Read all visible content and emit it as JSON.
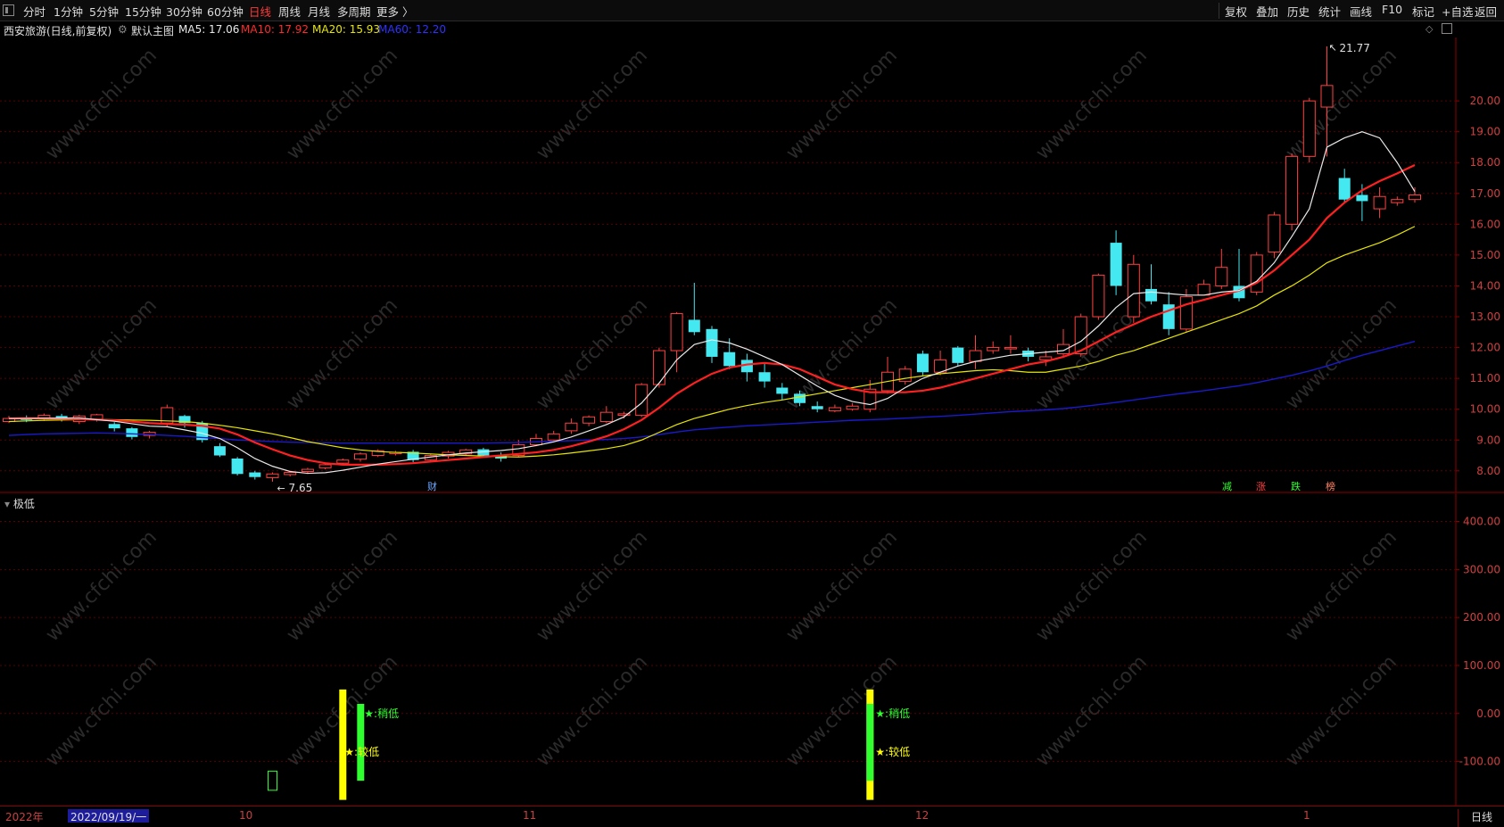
{
  "toolbar": {
    "periods": [
      "分时",
      "1分钟",
      "5分钟",
      "15分钟",
      "30分钟",
      "60分钟",
      "日线",
      "周线",
      "月线",
      "多周期",
      "更多 〉"
    ],
    "active_period": "日线",
    "right_buttons": [
      "复权",
      "叠加",
      "历史",
      "统计",
      "画线",
      "F10",
      "标记",
      "+自选",
      "返回"
    ]
  },
  "info": {
    "stock": "西安旅游(日线,前复权)",
    "template": "默认主图",
    "ma5": "MA5: 17.06",
    "ma10": "MA10: 17.92",
    "ma20": "MA20: 15.93",
    "ma60": "MA60: 12.20"
  },
  "colors": {
    "up": "#ff4040",
    "down": "#44e8f0",
    "ma5": "#e8e8e8",
    "ma10": "#ff2020",
    "ma20": "#e6e600",
    "ma60": "#1a1acc",
    "grid": "#5a0000",
    "axis": "#d04040"
  },
  "watermark": "www.cfchi.com",
  "main_axis": {
    "labels": [
      "20.00",
      "19.00",
      "18.00",
      "17.00",
      "16.00",
      "15.00",
      "14.00",
      "13.00",
      "12.00",
      "11.00",
      "10.00",
      "9.00",
      "8.00"
    ]
  },
  "annotations": {
    "high": "21.77",
    "low": "7.65",
    "event_cai": "财",
    "event_tags": [
      "减",
      "涨",
      "跌",
      "榜"
    ]
  },
  "sub_panel": {
    "title": "极低",
    "axis_labels": [
      "400.00",
      "300.00",
      "200.00",
      "100.00",
      "0.00",
      "-100.00"
    ],
    "signals": [
      {
        "label": "★:稍低",
        "color": "#30ff30"
      },
      {
        "label": "★:较低",
        "color": "#ffff00"
      },
      {
        "label": "★:稍低",
        "color": "#30ff30"
      },
      {
        "label": "★:较低",
        "color": "#ffff00"
      }
    ]
  },
  "date_axis": {
    "year": "2022年",
    "cursor": "2022/09/19/一",
    "months": [
      "10",
      "11",
      "12",
      "1"
    ],
    "period_tab": "日线"
  },
  "chart_data": {
    "type": "candlestick",
    "title": "西安旅游(日线,前复权)",
    "ylim": [
      7.3,
      22.0
    ],
    "candles": [
      [
        9.6,
        9.7,
        9.78,
        9.55
      ],
      [
        9.7,
        9.65,
        9.8,
        9.58
      ],
      [
        9.72,
        9.8,
        9.86,
        9.62
      ],
      [
        9.78,
        9.7,
        9.85,
        9.6
      ],
      [
        9.6,
        9.78,
        9.82,
        9.52
      ],
      [
        9.68,
        9.82,
        9.85,
        9.6
      ],
      [
        9.52,
        9.38,
        9.58,
        9.28
      ],
      [
        9.38,
        9.1,
        9.42,
        9.02
      ],
      [
        9.15,
        9.25,
        9.3,
        9.05
      ],
      [
        9.55,
        10.05,
        10.15,
        9.45
      ],
      [
        9.78,
        9.55,
        9.82,
        9.4
      ],
      [
        9.55,
        9.0,
        9.62,
        8.92
      ],
      [
        8.8,
        8.5,
        8.9,
        8.45
      ],
      [
        8.4,
        7.9,
        8.45,
        7.85
      ],
      [
        7.95,
        7.8,
        8.0,
        7.72
      ],
      [
        7.78,
        7.9,
        7.95,
        7.65
      ],
      [
        7.88,
        7.95,
        8.0,
        7.82
      ],
      [
        7.98,
        8.05,
        8.1,
        7.9
      ],
      [
        8.1,
        8.2,
        8.25,
        8.05
      ],
      [
        8.25,
        8.35,
        8.4,
        8.18
      ],
      [
        8.38,
        8.55,
        8.6,
        8.3
      ],
      [
        8.5,
        8.65,
        8.7,
        8.45
      ],
      [
        8.58,
        8.6,
        8.65,
        8.5
      ],
      [
        8.62,
        8.35,
        8.68,
        8.28
      ],
      [
        8.35,
        8.5,
        8.55,
        8.3
      ],
      [
        8.48,
        8.6,
        8.65,
        8.4
      ],
      [
        8.55,
        8.68,
        8.72,
        8.5
      ],
      [
        8.7,
        8.5,
        8.75,
        8.45
      ],
      [
        8.5,
        8.4,
        8.6,
        8.3
      ],
      [
        8.5,
        8.85,
        9.0,
        8.45
      ],
      [
        8.85,
        9.05,
        9.2,
        8.8
      ],
      [
        9.0,
        9.2,
        9.3,
        8.95
      ],
      [
        9.3,
        9.55,
        9.7,
        9.2
      ],
      [
        9.55,
        9.75,
        9.8,
        9.45
      ],
      [
        9.6,
        9.9,
        10.1,
        9.55
      ],
      [
        9.8,
        9.85,
        9.92,
        9.7
      ],
      [
        9.8,
        10.8,
        10.85,
        9.75
      ],
      [
        10.8,
        11.9,
        12.0,
        10.7
      ],
      [
        11.9,
        13.1,
        13.15,
        11.2
      ],
      [
        12.9,
        12.5,
        14.1,
        12.4
      ],
      [
        12.6,
        11.7,
        12.7,
        11.5
      ],
      [
        11.85,
        11.4,
        12.3,
        11.3
      ],
      [
        11.6,
        11.2,
        11.8,
        10.9
      ],
      [
        11.2,
        10.9,
        11.5,
        10.7
      ],
      [
        10.7,
        10.5,
        10.85,
        10.3
      ],
      [
        10.5,
        10.2,
        10.6,
        10.1
      ],
      [
        10.1,
        10.0,
        10.25,
        9.9
      ],
      [
        9.95,
        10.05,
        10.15,
        9.9
      ],
      [
        10.0,
        10.1,
        10.2,
        9.95
      ],
      [
        10.0,
        10.65,
        10.95,
        9.9
      ],
      [
        10.6,
        11.2,
        11.7,
        10.5
      ],
      [
        10.9,
        11.3,
        11.4,
        10.8
      ],
      [
        11.8,
        11.2,
        11.9,
        11.1
      ],
      [
        11.2,
        11.6,
        11.9,
        11.1
      ],
      [
        12.0,
        11.5,
        12.05,
        11.4
      ],
      [
        11.55,
        11.9,
        12.4,
        11.3
      ],
      [
        11.9,
        12.0,
        12.2,
        11.8
      ],
      [
        12.0,
        12.0,
        12.4,
        11.8
      ],
      [
        11.9,
        11.7,
        12.0,
        11.55
      ],
      [
        11.6,
        11.7,
        11.9,
        11.4
      ],
      [
        11.8,
        12.1,
        12.6,
        11.7
      ],
      [
        11.8,
        13.0,
        13.1,
        11.7
      ],
      [
        13.0,
        14.35,
        14.4,
        12.9
      ],
      [
        15.4,
        14.0,
        15.8,
        13.7
      ],
      [
        13.0,
        14.7,
        15.0,
        12.8
      ],
      [
        13.9,
        13.5,
        14.7,
        13.4
      ],
      [
        13.4,
        12.6,
        13.8,
        12.4
      ],
      [
        12.6,
        13.65,
        13.9,
        12.5
      ],
      [
        13.7,
        14.05,
        14.2,
        13.7
      ],
      [
        14.0,
        14.6,
        15.2,
        13.9
      ],
      [
        14.0,
        13.6,
        15.2,
        13.5
      ],
      [
        13.8,
        15.0,
        15.1,
        13.7
      ],
      [
        15.1,
        16.3,
        16.4,
        14.9
      ],
      [
        16.0,
        18.2,
        18.3,
        15.8
      ],
      [
        18.2,
        20.0,
        20.1,
        18.0
      ],
      [
        19.8,
        20.5,
        21.77,
        18.2
      ],
      [
        17.5,
        16.8,
        17.8,
        16.7
      ],
      [
        16.95,
        16.75,
        17.3,
        16.1
      ],
      [
        16.5,
        16.9,
        17.2,
        16.2
      ],
      [
        16.7,
        16.8,
        16.9,
        16.6
      ],
      [
        16.8,
        16.95,
        17.2,
        16.7
      ]
    ],
    "ma5": [
      9.7,
      9.7,
      9.71,
      9.71,
      9.72,
      9.66,
      9.61,
      9.53,
      9.45,
      9.43,
      9.33,
      9.22,
      9.05,
      8.75,
      8.4,
      8.15,
      7.98,
      7.92,
      7.94,
      8.02,
      8.12,
      8.22,
      8.3,
      8.38,
      8.45,
      8.52,
      8.58,
      8.62,
      8.66,
      8.72,
      8.82,
      8.94,
      9.1,
      9.3,
      9.5,
      9.75,
      10.2,
      10.85,
      11.6,
      12.1,
      12.25,
      12.15,
      11.95,
      11.7,
      11.45,
      11.1,
      10.75,
      10.45,
      10.25,
      10.15,
      10.35,
      10.7,
      11.0,
      11.2,
      11.4,
      11.55,
      11.65,
      11.75,
      11.8,
      11.85,
      11.9,
      12.2,
      12.7,
      13.3,
      13.75,
      13.8,
      13.75,
      13.7,
      13.7,
      13.8,
      13.85,
      14.15,
      14.75,
      15.6,
      16.5,
      18.5,
      18.8,
      19.0,
      18.8,
      18.0,
      17.06
    ],
    "ma10": [
      9.7,
      9.71,
      9.7,
      9.69,
      9.68,
      9.66,
      9.64,
      9.6,
      9.55,
      9.52,
      9.5,
      9.46,
      9.37,
      9.18,
      8.92,
      8.7,
      8.5,
      8.35,
      8.25,
      8.2,
      8.2,
      8.2,
      8.22,
      8.25,
      8.3,
      8.35,
      8.4,
      8.45,
      8.5,
      8.55,
      8.6,
      8.68,
      8.8,
      8.95,
      9.12,
      9.35,
      9.65,
      10.05,
      10.5,
      10.85,
      11.15,
      11.35,
      11.45,
      11.5,
      11.45,
      11.3,
      11.05,
      10.8,
      10.65,
      10.55,
      10.55,
      10.55,
      10.6,
      10.7,
      10.85,
      11.0,
      11.15,
      11.3,
      11.45,
      11.55,
      11.7,
      11.9,
      12.2,
      12.5,
      12.75,
      13.0,
      13.2,
      13.4,
      13.55,
      13.7,
      13.85,
      14.1,
      14.5,
      15.0,
      15.5,
      16.2,
      16.7,
      17.1,
      17.4,
      17.65,
      17.92
    ],
    "ma20": [
      9.6,
      9.62,
      9.64,
      9.65,
      9.66,
      9.67,
      9.66,
      9.65,
      9.64,
      9.62,
      9.6,
      9.55,
      9.48,
      9.4,
      9.3,
      9.2,
      9.08,
      8.95,
      8.85,
      8.75,
      8.68,
      8.63,
      8.6,
      8.58,
      8.55,
      8.52,
      8.5,
      8.48,
      8.46,
      8.45,
      8.48,
      8.52,
      8.58,
      8.65,
      8.72,
      8.82,
      9.0,
      9.25,
      9.5,
      9.7,
      9.85,
      10.0,
      10.12,
      10.22,
      10.3,
      10.4,
      10.5,
      10.6,
      10.7,
      10.8,
      10.9,
      11.0,
      11.08,
      11.15,
      11.2,
      11.25,
      11.28,
      11.25,
      11.2,
      11.2,
      11.3,
      11.4,
      11.55,
      11.75,
      11.9,
      12.1,
      12.3,
      12.5,
      12.7,
      12.9,
      13.1,
      13.35,
      13.7,
      14.0,
      14.35,
      14.75,
      15.0,
      15.2,
      15.4,
      15.65,
      15.93
    ],
    "ma60": [
      9.15,
      9.18,
      9.2,
      9.21,
      9.22,
      9.23,
      9.22,
      9.2,
      9.18,
      9.15,
      9.12,
      9.08,
      9.05,
      9.0,
      8.98,
      8.95,
      8.93,
      8.92,
      8.91,
      8.9,
      8.9,
      8.9,
      8.9,
      8.9,
      8.9,
      8.9,
      8.9,
      8.9,
      8.91,
      8.92,
      8.94,
      8.96,
      8.98,
      9.0,
      9.02,
      9.05,
      9.1,
      9.18,
      9.26,
      9.33,
      9.38,
      9.42,
      9.46,
      9.49,
      9.52,
      9.55,
      9.58,
      9.61,
      9.64,
      9.66,
      9.68,
      9.71,
      9.74,
      9.77,
      9.8,
      9.84,
      9.88,
      9.92,
      9.95,
      9.98,
      10.02,
      10.08,
      10.15,
      10.22,
      10.3,
      10.38,
      10.46,
      10.53,
      10.6,
      10.68,
      10.76,
      10.86,
      10.98,
      11.1,
      11.24,
      11.4,
      11.58,
      11.75,
      11.9,
      12.05,
      12.2
    ],
    "sub_ylim": [
      -190,
      440
    ],
    "sub_bars": [
      {
        "index": 15,
        "top": -120,
        "bottom": -160,
        "color": "#30ff30",
        "filled": false
      },
      {
        "index": 19,
        "top": 50,
        "bottom": -180,
        "color": "#ffff00",
        "filled": true
      },
      {
        "index": 20,
        "top": 20,
        "bottom": -140,
        "color": "#30ff30",
        "filled": true
      },
      {
        "index": 49,
        "top": 50,
        "bottom": -180,
        "color": "#ffff00",
        "filled": true
      },
      {
        "index": 49,
        "top": 20,
        "bottom": -140,
        "color": "#30ff30",
        "filled": true
      }
    ]
  }
}
